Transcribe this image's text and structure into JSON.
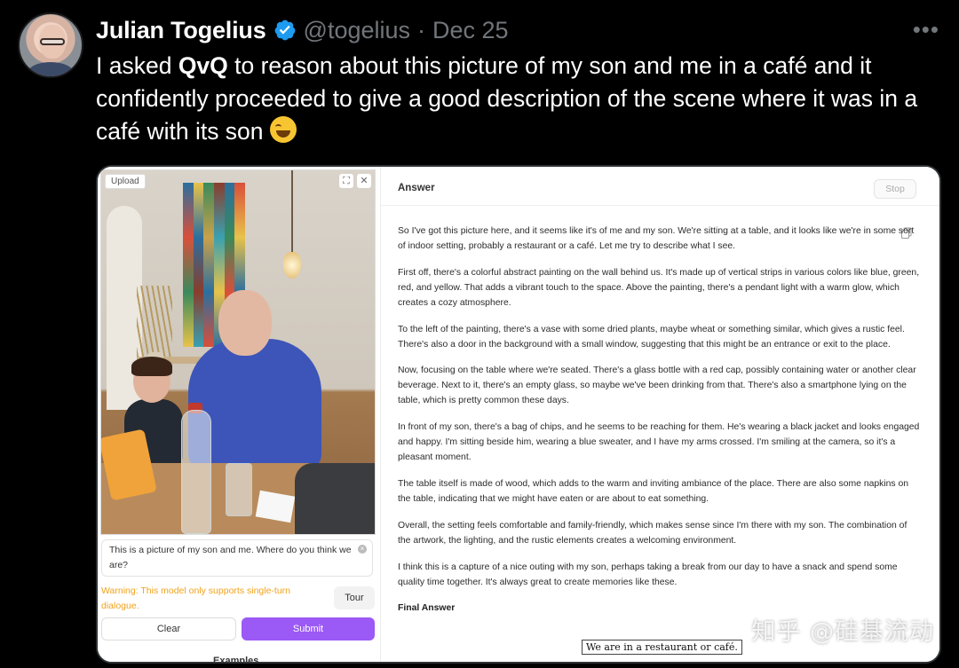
{
  "tweet": {
    "display_name": "Julian Togelius",
    "handle": "@togelius",
    "separator": "·",
    "date": "Dec 25",
    "more": "•••",
    "text_before": "I asked ",
    "text_bold": "QvQ",
    "text_after": " to reason about this picture of my son and me in a café and it confidently proceeded to give a good description of the scene where it was in a café with its son",
    "emoji": "face-with-tears-of-joy"
  },
  "app": {
    "upload_tag": "Upload",
    "prompt_text": "This is a picture of my son and me. Where do you think we are?",
    "warning": "Warning: This model only supports single-turn dialogue.",
    "tour_label": "Tour",
    "clear_label": "Clear",
    "submit_label": "Submit",
    "examples_label": "Examples",
    "answer_title": "Answer",
    "stop_label": "Stop",
    "paragraphs": [
      "So I've got this picture here, and it seems like it's of me and my son. We're sitting at a table, and it looks like we're in some sort of indoor setting, probably a restaurant or a café. Let me try to describe what I see.",
      "First off, there's a colorful abstract painting on the wall behind us. It's made up of vertical strips in various colors like blue, green, red, and yellow. That adds a vibrant touch to the space. Above the painting, there's a pendant light with a warm glow, which creates a cozy atmosphere.",
      "To the left of the painting, there's a vase with some dried plants, maybe wheat or something similar, which gives a rustic feel. There's also a door in the background with a small window, suggesting that this might be an entrance or exit to the place.",
      "Now, focusing on the table where we're seated. There's a glass bottle with a red cap, possibly containing water or another clear beverage. Next to it, there's an empty glass, so maybe we've been drinking from that. There's also a smartphone lying on the table, which is pretty common these days.",
      "In front of my son, there's a bag of chips, and he seems to be reaching for them. He's wearing a black jacket and looks engaged and happy. I'm sitting beside him, wearing a blue sweater, and I have my arms crossed. I'm smiling at the camera, so it's a pleasant moment.",
      "The table itself is made of wood, which adds to the warm and inviting ambiance of the place. There are also some napkins on the table, indicating that we might have eaten or are about to eat something.",
      "Overall, the setting feels comfortable and family-friendly, which makes sense since I'm there with my son. The combination of the artwork, the lighting, and the rustic elements creates a welcoming environment.",
      "I think this is a capture of a nice outing with my son, perhaps taking a break from our day to have a snack and spend some quality time together. It's always great to create memories like these."
    ],
    "final_answer_title": "Final Answer",
    "final_answer": "We are in a restaurant or café."
  },
  "watermark": "知乎 @硅基流动",
  "colors": {
    "verified": "#1d9bf0",
    "submit": "#9b59f5",
    "warning": "#f0a31c"
  }
}
